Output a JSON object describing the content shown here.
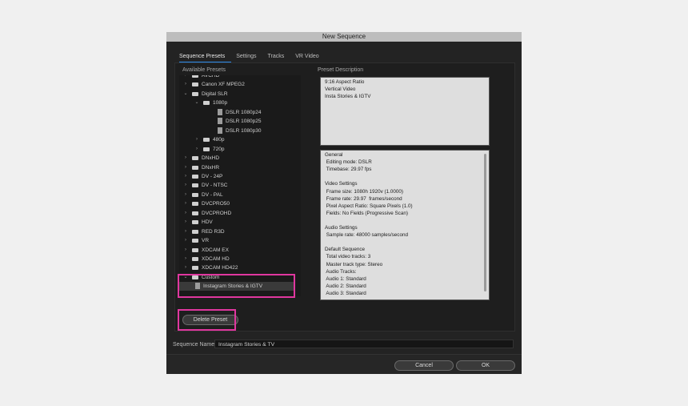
{
  "window": {
    "title": "New Sequence"
  },
  "tabs": [
    {
      "label": "Sequence Presets",
      "active": true
    },
    {
      "label": "Settings",
      "active": false
    },
    {
      "label": "Tracks",
      "active": false
    },
    {
      "label": "VR Video",
      "active": false
    }
  ],
  "presets": {
    "heading": "Available Presets",
    "items": [
      {
        "label": "AVCHD",
        "type": "folder",
        "expanded": false
      },
      {
        "label": "Canon XF MPEG2",
        "type": "folder",
        "expanded": false
      },
      {
        "label": "Digital SLR",
        "type": "folder",
        "expanded": true
      },
      {
        "label": "1080p",
        "type": "folder",
        "expanded": true
      },
      {
        "label": "DSLR 1080p24",
        "type": "file"
      },
      {
        "label": "DSLR 1080p25",
        "type": "file"
      },
      {
        "label": "DSLR 1080p30",
        "type": "file"
      },
      {
        "label": "480p",
        "type": "folder",
        "expanded": false
      },
      {
        "label": "720p",
        "type": "folder",
        "expanded": false
      },
      {
        "label": "DNxHD",
        "type": "folder",
        "expanded": false
      },
      {
        "label": "DNxHR",
        "type": "folder",
        "expanded": false
      },
      {
        "label": "DV - 24P",
        "type": "folder",
        "expanded": false
      },
      {
        "label": "DV - NTSC",
        "type": "folder",
        "expanded": false
      },
      {
        "label": "DV - PAL",
        "type": "folder",
        "expanded": false
      },
      {
        "label": "DVCPRO50",
        "type": "folder",
        "expanded": false
      },
      {
        "label": "DVCPROHD",
        "type": "folder",
        "expanded": false
      },
      {
        "label": "HDV",
        "type": "folder",
        "expanded": false
      },
      {
        "label": "RED R3D",
        "type": "folder",
        "expanded": false
      },
      {
        "label": "VR",
        "type": "folder",
        "expanded": false
      },
      {
        "label": "XDCAM EX",
        "type": "folder",
        "expanded": false
      },
      {
        "label": "XDCAM HD",
        "type": "folder",
        "expanded": false
      },
      {
        "label": "XDCAM HD422",
        "type": "folder",
        "expanded": false
      },
      {
        "label": "Custom",
        "type": "folder",
        "expanded": true
      },
      {
        "label": "Instagram Stories & IGTV",
        "type": "file",
        "selected": true
      }
    ]
  },
  "description": {
    "heading": "Preset Description",
    "summary": [
      "9:16 Aspect Ratio",
      "Vertical Video",
      "Insta Stories & IGTV"
    ],
    "details": [
      "General",
      " Editing mode: DSLR",
      " Timebase: 29.97 fps",
      "",
      "Video Settings",
      " Frame size: 1080h 1920v (1.0000)",
      " Frame rate: 29.97  frames/second",
      " Pixel Aspect Ratio: Square Pixels (1.0)",
      " Fields: No Fields (Progressive Scan)",
      "",
      "Audio Settings",
      " Sample rate: 48000 samples/second",
      "",
      "Default Sequence",
      " Total video tracks: 3",
      " Master track type: Stereo",
      " Audio Tracks:",
      " Audio 1: Standard",
      " Audio 2: Standard",
      " Audio 3: Standard"
    ]
  },
  "buttons": {
    "delete_preset": "Delete Preset",
    "cancel": "Cancel",
    "ok": "OK"
  },
  "sequence_name": {
    "label": "Sequence Name:",
    "value": "Instagram Stories & TV"
  },
  "colors": {
    "highlight": "#e0379f",
    "tab_underline": "#2d8ceb"
  }
}
